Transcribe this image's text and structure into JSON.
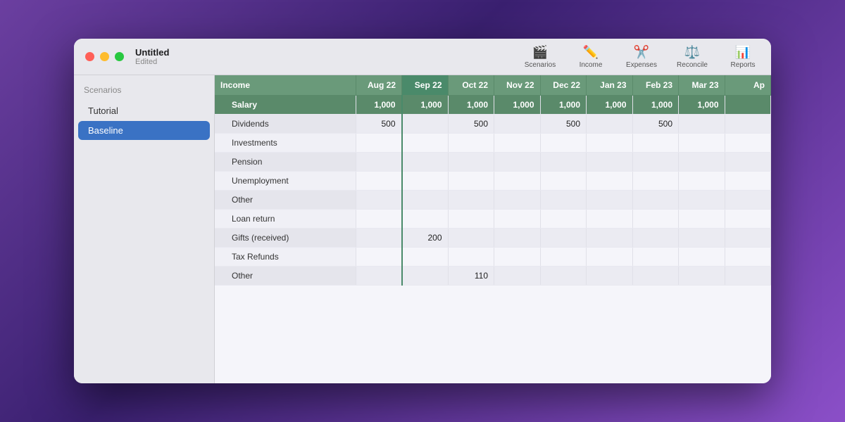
{
  "window": {
    "title": "Untitled",
    "subtitle": "Edited"
  },
  "toolbar": {
    "items": [
      {
        "id": "scenarios",
        "label": "Scenarios",
        "icon": "🎬"
      },
      {
        "id": "income",
        "label": "Income",
        "icon": "✏️"
      },
      {
        "id": "expenses",
        "label": "Expenses",
        "icon": "✂️"
      },
      {
        "id": "reconcile",
        "label": "Reconcile",
        "icon": "⚖️"
      },
      {
        "id": "reports",
        "label": "Reports",
        "icon": "📊"
      }
    ]
  },
  "sidebar": {
    "header": "Scenarios",
    "items": [
      {
        "id": "tutorial",
        "label": "Tutorial",
        "active": false
      },
      {
        "id": "baseline",
        "label": "Baseline",
        "active": true
      }
    ]
  },
  "spreadsheet": {
    "columns": [
      "Income",
      "Aug 22",
      "Sep 22",
      "Oct 22",
      "Nov 22",
      "Dec 22",
      "Jan 23",
      "Feb 23",
      "Mar 23",
      "Ap"
    ],
    "rows": [
      {
        "label": "Salary",
        "values": [
          "1,000",
          "1,000",
          "1,000",
          "1,000",
          "1,000",
          "1,000",
          "1,000",
          "1,000",
          ""
        ],
        "type": "salary"
      },
      {
        "label": "Dividends",
        "values": [
          "500",
          "",
          "500",
          "",
          "500",
          "",
          "500",
          "",
          ""
        ],
        "type": "normal"
      },
      {
        "label": "Investments",
        "values": [
          "",
          "",
          "",
          "",
          "",
          "",
          "",
          "",
          ""
        ],
        "type": "normal"
      },
      {
        "label": "Pension",
        "values": [
          "",
          "",
          "",
          "",
          "",
          "",
          "",
          "",
          ""
        ],
        "type": "normal"
      },
      {
        "label": "Unemployment",
        "values": [
          "",
          "",
          "",
          "",
          "",
          "",
          "",
          "",
          ""
        ],
        "type": "normal"
      },
      {
        "label": "Other",
        "values": [
          "",
          "",
          "",
          "",
          "",
          "",
          "",
          "",
          ""
        ],
        "type": "normal"
      },
      {
        "label": "Loan return",
        "values": [
          "",
          "",
          "",
          "",
          "",
          "",
          "",
          "",
          ""
        ],
        "type": "normal"
      },
      {
        "label": "Gifts (received)",
        "values": [
          "",
          "200",
          "",
          "",
          "",
          "",
          "",
          "",
          ""
        ],
        "type": "normal"
      },
      {
        "label": "Tax Refunds",
        "values": [
          "",
          "",
          "",
          "",
          "",
          "",
          "",
          "",
          ""
        ],
        "type": "normal"
      },
      {
        "label": "Other",
        "values": [
          "",
          "",
          "110",
          "",
          "",
          "",
          "",
          "",
          ""
        ],
        "type": "normal"
      }
    ]
  }
}
